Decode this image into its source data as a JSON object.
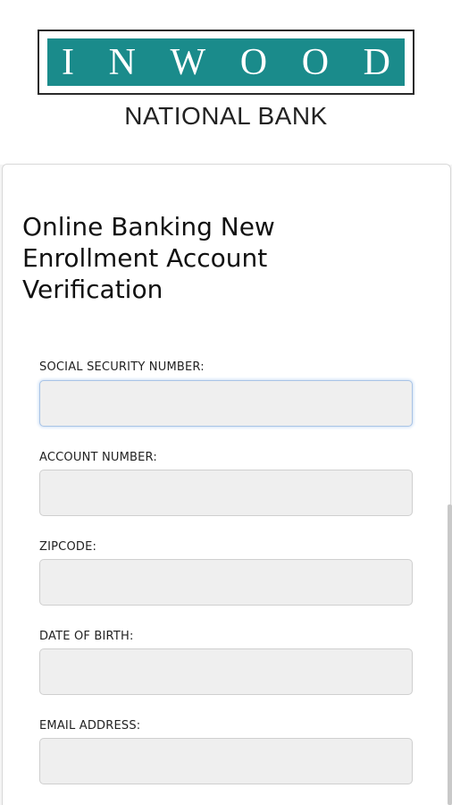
{
  "logo": {
    "letters": [
      "I",
      "N",
      "W",
      "O",
      "O",
      "D"
    ],
    "subtitle": "NATIONAL BANK",
    "brand_color": "#1a8b8b"
  },
  "form": {
    "title": "Online Banking New Enrollment Account Verification",
    "fields": [
      {
        "label": "SOCIAL SECURITY NUMBER:",
        "value": "",
        "focused": true
      },
      {
        "label": "ACCOUNT NUMBER:",
        "value": ""
      },
      {
        "label": "ZIPCODE:",
        "value": ""
      },
      {
        "label": "DATE OF BIRTH:",
        "value": ""
      },
      {
        "label": "EMAIL ADDRESS:",
        "value": ""
      }
    ]
  }
}
